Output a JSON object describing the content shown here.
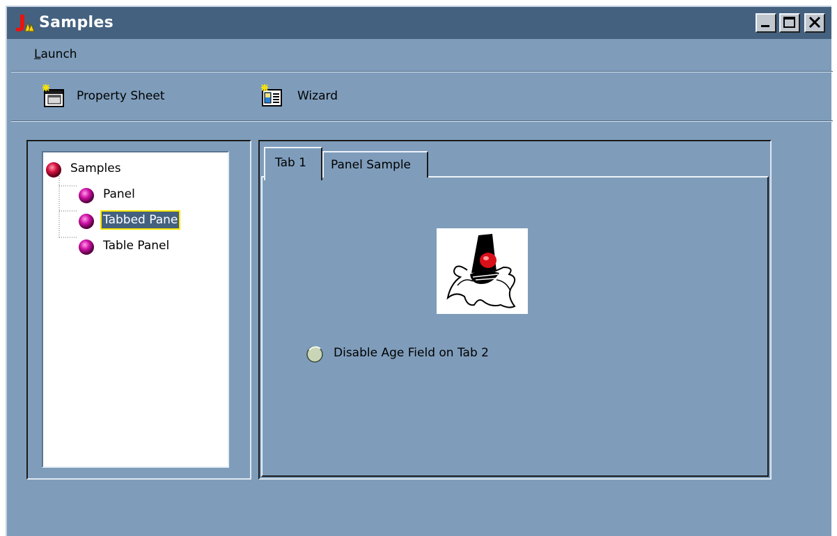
{
  "window": {
    "title": "Samples",
    "colors": {
      "titlebar": "#44617f",
      "background": "#7f9dbb",
      "selection": "#44617f",
      "focus": "#ffe600"
    }
  },
  "menu": {
    "launch_label": "Launch",
    "launch_mnemonic": "L",
    "launch_rest": "aunch"
  },
  "toolbar": {
    "property_sheet_label": "Property Sheet",
    "wizard_label": "Wizard"
  },
  "tree": {
    "root": "Samples",
    "children": [
      "Panel",
      "Tabbed Pane",
      "Table Panel"
    ],
    "selected": "Tabbed Pane"
  },
  "tabs": {
    "tab1_label": "Tab 1",
    "tab2_label": "Panel Sample",
    "active": "Tab 1"
  },
  "content": {
    "radio_label": "Disable Age Field on Tab 2",
    "radio_checked": false
  }
}
